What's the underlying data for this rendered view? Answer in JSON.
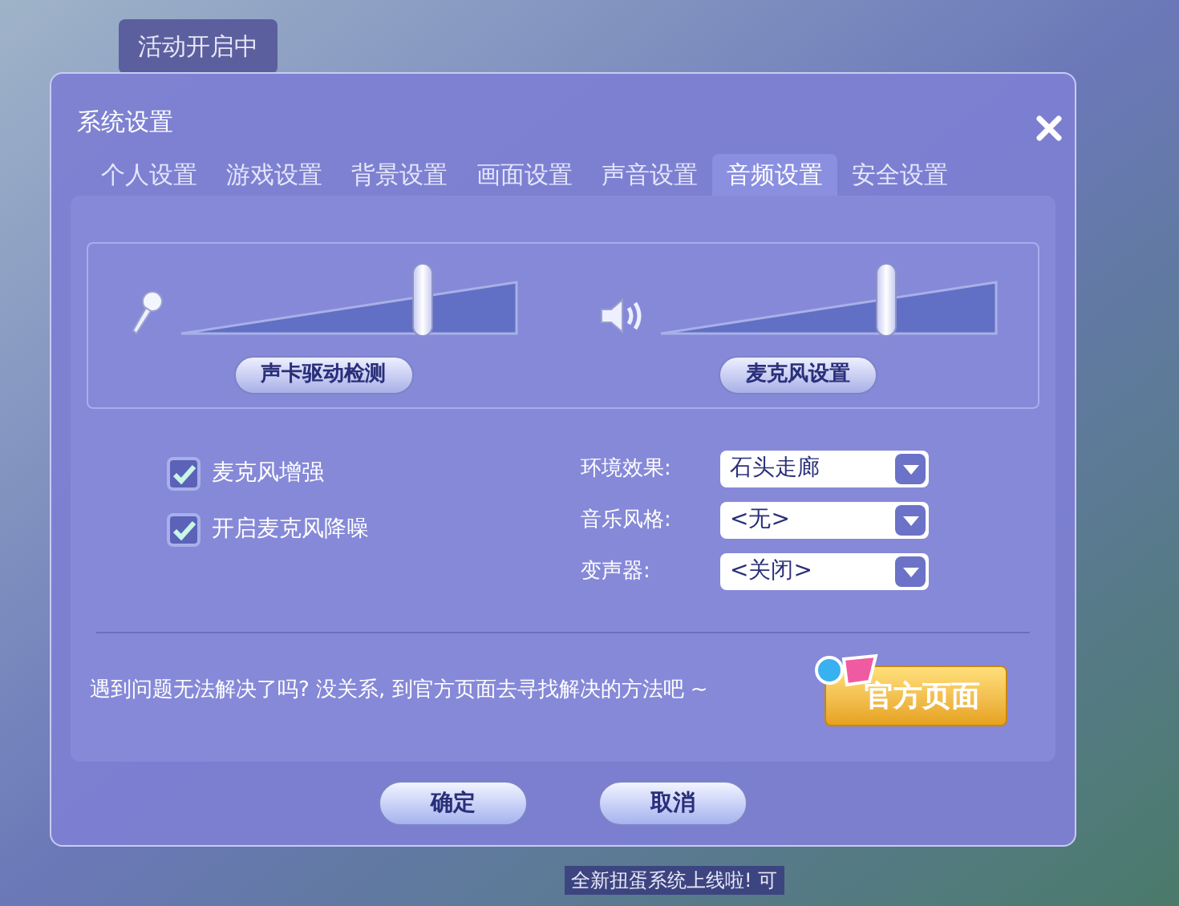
{
  "background": {
    "event_button": "活动开启中",
    "notice": "全新扭蛋系统上线啦! 可"
  },
  "window": {
    "title": "系统设置"
  },
  "tabs": [
    {
      "label": "个人设置",
      "selected": false
    },
    {
      "label": "游戏设置",
      "selected": false
    },
    {
      "label": "背景设置",
      "selected": false
    },
    {
      "label": "画面设置",
      "selected": false
    },
    {
      "label": "声音设置",
      "selected": false
    },
    {
      "label": "音频设置",
      "selected": true
    },
    {
      "label": "安全设置",
      "selected": false
    }
  ],
  "volume": [
    {
      "kind": "microphone",
      "level": 0.72,
      "button": "声卡驱动检测"
    },
    {
      "kind": "speaker",
      "level": 0.67,
      "button": "麦克风设置"
    }
  ],
  "checkboxes": [
    {
      "label": "麦克风增强",
      "checked": true
    },
    {
      "label": "开启麦克风降噪",
      "checked": true
    }
  ],
  "dropdowns": [
    {
      "label": "环境效果:",
      "value": "石头走廊"
    },
    {
      "label": "音乐风格:",
      "value": "<无>"
    },
    {
      "label": "变声器:",
      "value": "<关闭>"
    }
  ],
  "help_text": "遇到问题无法解决了吗? 没关系, 到官方页面去寻找解决的方法吧 ~",
  "official_button": "官方页面",
  "buttons": [
    "确定",
    "取消"
  ]
}
